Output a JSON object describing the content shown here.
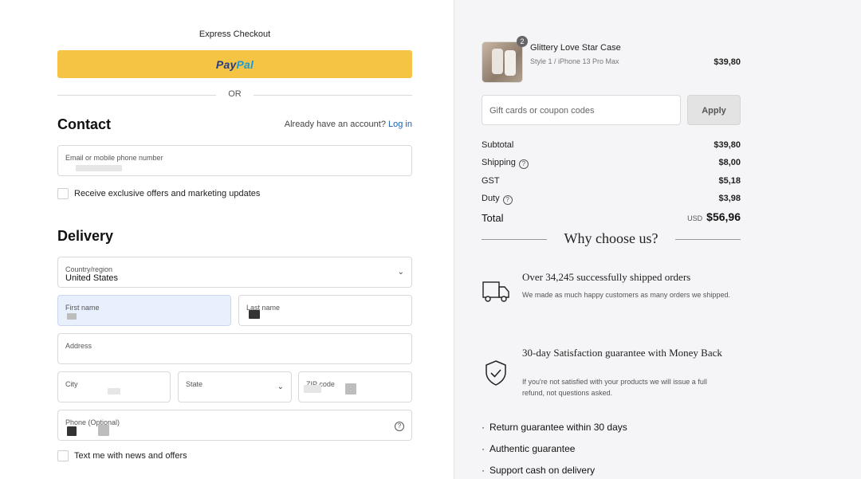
{
  "checkout": {
    "express_title": "Express Checkout",
    "paypal_part1": "Pay",
    "paypal_part2": "Pal",
    "or_text": "OR"
  },
  "contact": {
    "title": "Contact",
    "account_prompt": "Already have an account?",
    "login_link": "Log in",
    "email_label": "Email or mobile phone number",
    "marketing_checkbox": "Receive exclusive offers and marketing updates"
  },
  "delivery": {
    "title": "Delivery",
    "country_label": "Country/region",
    "country_value": "United States",
    "first_name_label": "First name",
    "last_name_label": "Last name",
    "address_label": "Address",
    "city_label": "City",
    "state_label": "State",
    "zip_label": "ZIP code",
    "phone_label": "Phone (Optional)",
    "sms_checkbox": "Text me with news and offers"
  },
  "order": {
    "quantity": "2",
    "product_name": "Glittery Love Star Case",
    "product_variant": "Style 1 / iPhone 13 Pro Max",
    "product_price": "$39,80",
    "coupon_placeholder": "Gift cards or coupon codes",
    "apply_label": "Apply",
    "subtotal_label": "Subtotal",
    "subtotal_value": "$39,80",
    "shipping_label": "Shipping",
    "shipping_value": "$8,00",
    "gst_label": "GST",
    "gst_value": "$5,18",
    "duty_label": "Duty",
    "duty_value": "$3,98",
    "total_label": "Total",
    "total_currency": "USD",
    "total_value": "$56,96"
  },
  "why": {
    "title": "Why choose us?",
    "features": [
      {
        "icon": "truck-icon",
        "title": "Over 34,245 successfully shipped orders",
        "desc": "We made as much happy customers as many orders we shipped."
      },
      {
        "icon": "shield-check-icon",
        "title": "30-day Satisfaction guarantee with Money Back",
        "desc": "If you're not satisfied with your products we will issue a full refund, not questions asked."
      }
    ],
    "bullets": [
      "Return guarantee within 30 days",
      "Authentic guarantee",
      "Support cash on delivery"
    ]
  },
  "colors": {
    "paypal_yellow": "#f6c445",
    "link_blue": "#1a5fb4",
    "summary_bg": "#f5f5f7",
    "autofill_bg": "#e8f0fe"
  }
}
